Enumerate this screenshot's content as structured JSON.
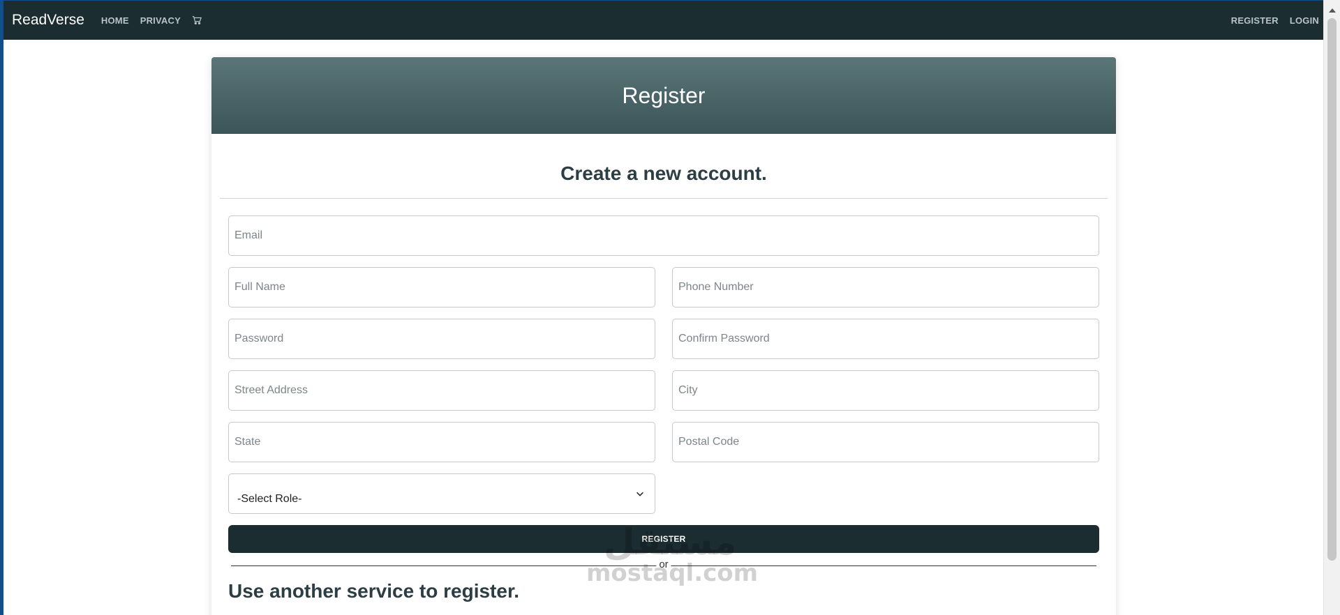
{
  "navbar": {
    "brand": "ReadVerse",
    "links": [
      "HOME",
      "PRIVACY"
    ],
    "cart_icon": "cart-icon",
    "right_links": [
      "REGISTER",
      "LOGIN"
    ],
    "background": "#1b2d30"
  },
  "card": {
    "title": "Register",
    "subtitle": "Create a new account.",
    "header_gradient": [
      "#5b7678",
      "#3b5558"
    ]
  },
  "form": {
    "email_placeholder": "Email",
    "full_name_placeholder": "Full Name",
    "phone_placeholder": "Phone Number",
    "password_placeholder": "Password",
    "confirm_password_placeholder": "Confirm Password",
    "street_placeholder": "Street Address",
    "city_placeholder": "City",
    "state_placeholder": "State",
    "postal_placeholder": "Postal Code",
    "role_select_value": "-Select Role-",
    "submit_label": "REGISTER"
  },
  "separator": {
    "text": "or"
  },
  "external": {
    "heading": "Use another service to register."
  },
  "watermark": {
    "arabic": "مستقل",
    "latin": "mostaql.com"
  }
}
